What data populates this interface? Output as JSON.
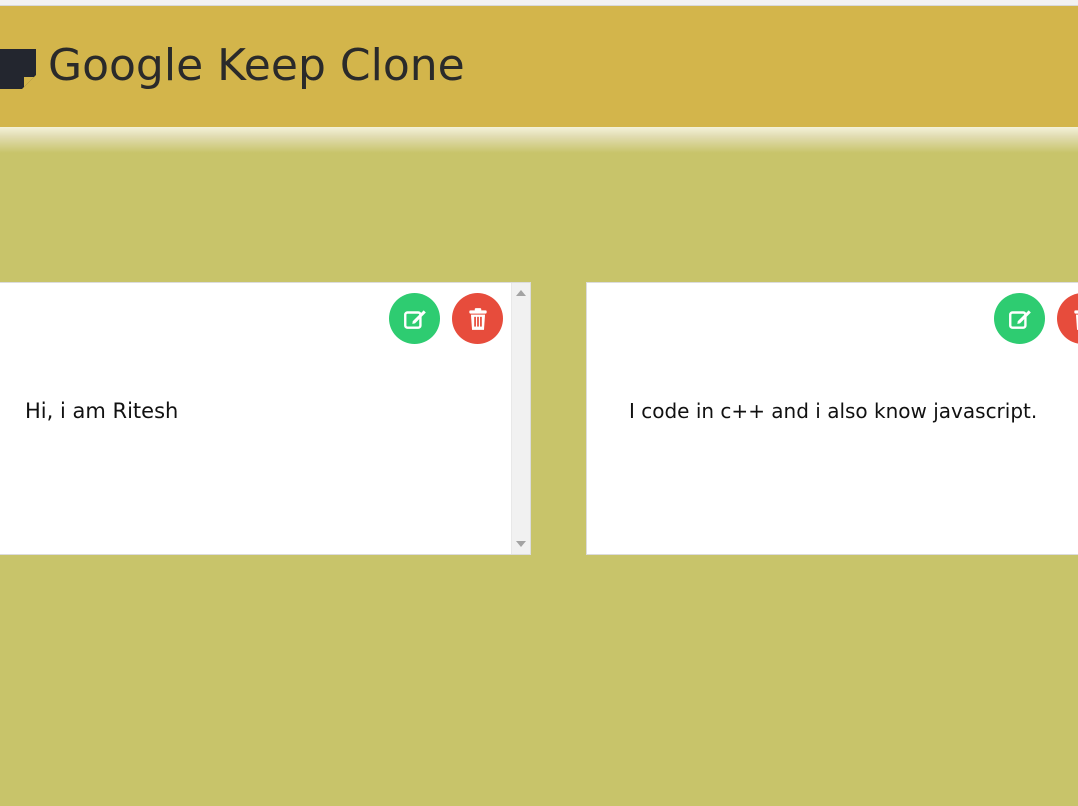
{
  "app": {
    "title": "Google Keep Clone",
    "logo_icon": "sticky-note-icon"
  },
  "colors": {
    "page_background": "#c8c46a",
    "header_background": "#d3b54b",
    "edit_button": "#2ecc71",
    "delete_button": "#e74c3c",
    "note_background": "#ffffff"
  },
  "notes": [
    {
      "text": "Hi, i am Ritesh",
      "edit_icon": "edit-icon",
      "delete_icon": "trash-icon"
    },
    {
      "text": "I code in c++ and i also know javascript.",
      "edit_icon": "edit-icon",
      "delete_icon": "trash-icon"
    }
  ]
}
